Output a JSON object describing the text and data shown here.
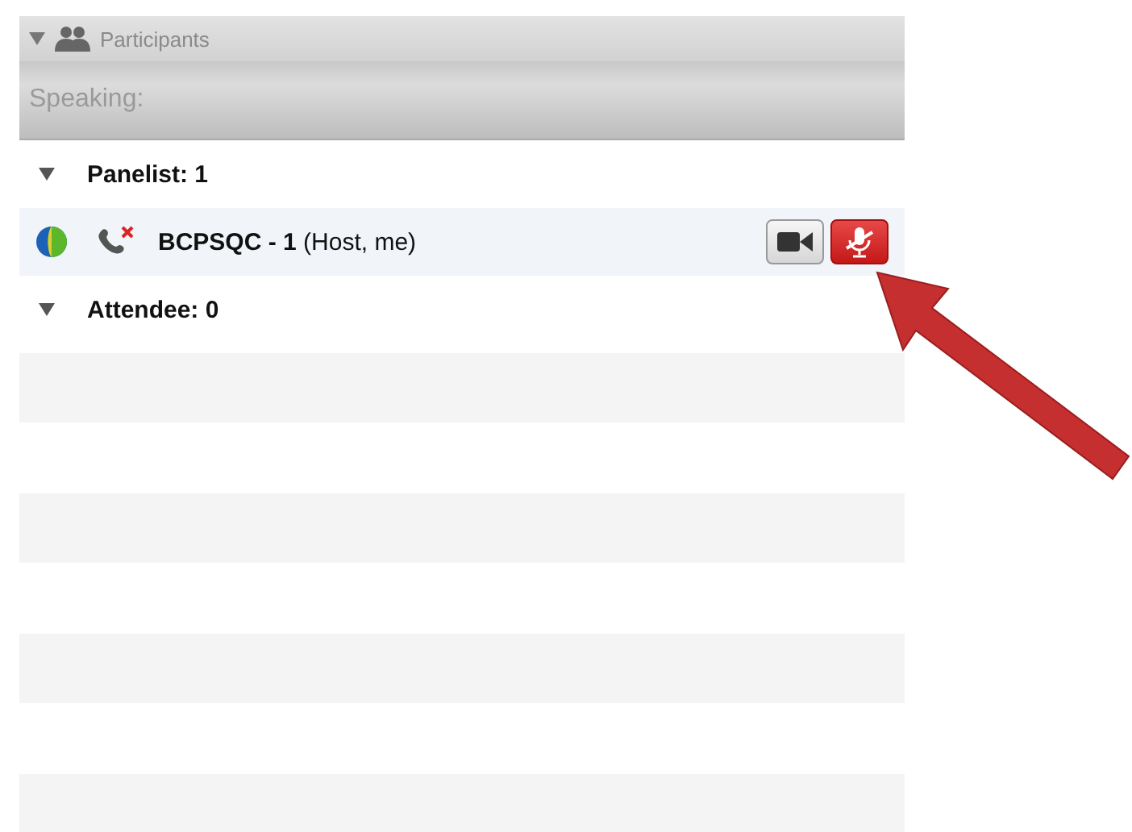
{
  "panel": {
    "title": "Participants",
    "expanded": true
  },
  "speaking": {
    "label": "Speaking:"
  },
  "groups": [
    {
      "label": "Panelist: 1",
      "expanded": true,
      "members": [
        {
          "name": "BCPSQC - 1",
          "role": "(Host, me)",
          "phone_connected": false,
          "video_on": false,
          "muted": true,
          "selected": true
        }
      ]
    },
    {
      "label": "Attendee: 0",
      "expanded": true
    }
  ]
}
